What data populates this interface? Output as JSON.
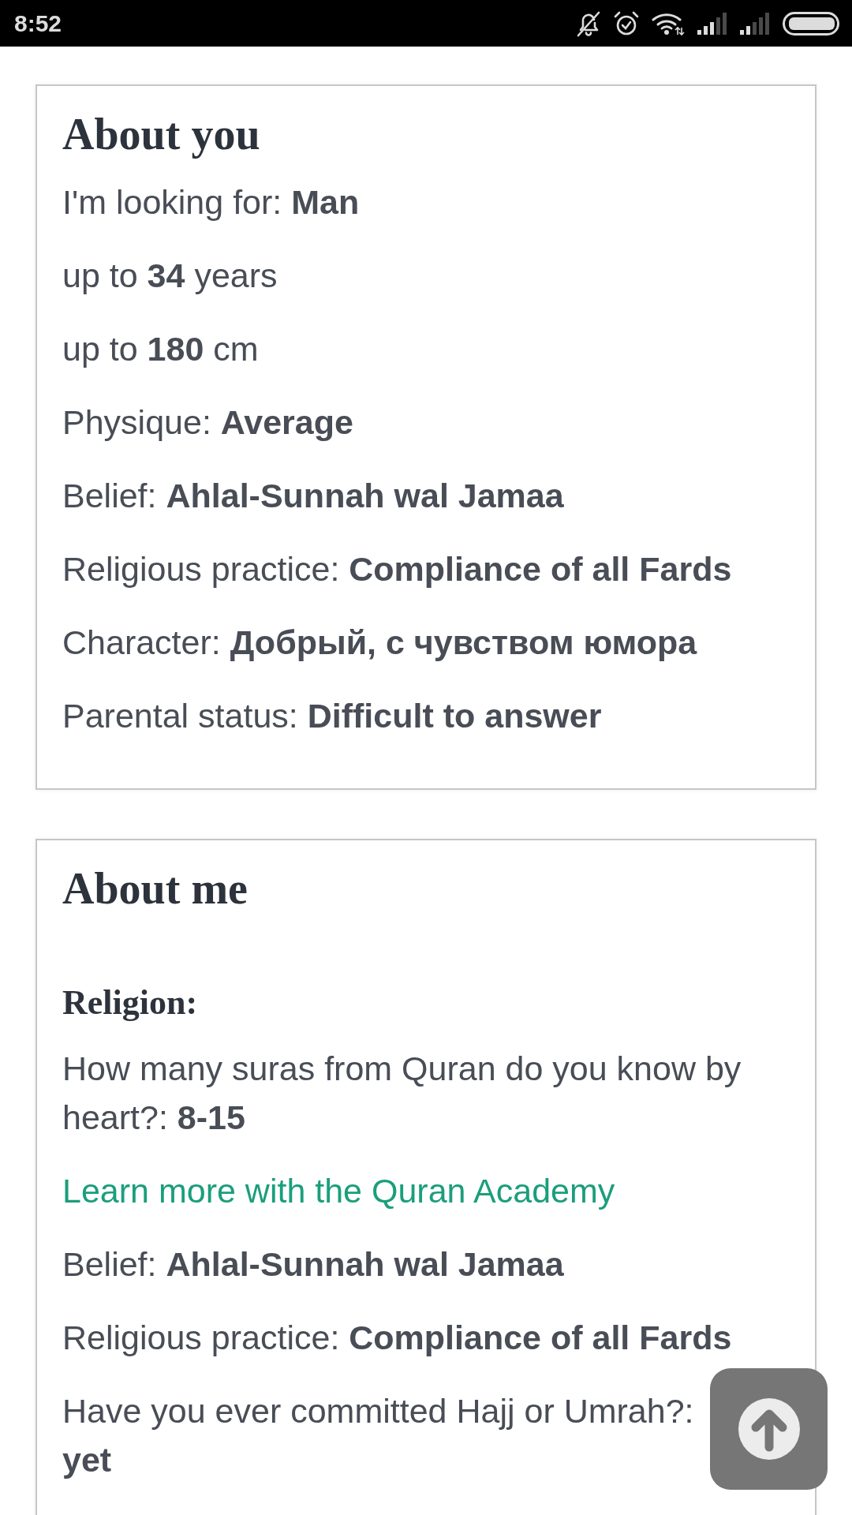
{
  "status_bar": {
    "time": "8:52"
  },
  "sections": [
    {
      "title": "About you",
      "items": [
        {
          "kind": "text",
          "text": "I'm looking for: **Man**"
        },
        {
          "kind": "text",
          "text": "up to **34** years"
        },
        {
          "kind": "text",
          "text": "up to **180** cm"
        },
        {
          "kind": "text",
          "text": "Physique: **Average**"
        },
        {
          "kind": "text",
          "text": "Belief: **Ahlal-Sunnah wal Jamaa**"
        },
        {
          "kind": "text",
          "text": "Religious practice: **Compliance of all Fards**"
        },
        {
          "kind": "text",
          "text": "Character: **Добрый, с чувством юмора**"
        },
        {
          "kind": "text",
          "text": "Parental status: **Difficult to answer**"
        }
      ]
    },
    {
      "title": "About me",
      "groups": [
        {
          "heading": "Religion:",
          "items": [
            {
              "kind": "text",
              "text": "How many suras from Quran do you know by heart?: **8-15**"
            },
            {
              "kind": "link",
              "text": "Learn more with the Quran Academy"
            },
            {
              "kind": "text",
              "text": "Belief: **Ahlal-Sunnah wal Jamaa**"
            },
            {
              "kind": "text",
              "text": "Religious practice: **Compliance of all Fards**"
            },
            {
              "kind": "stacked",
              "label": "Have you ever committed Hajj or Umrah?:",
              "value": "yet"
            }
          ]
        }
      ]
    }
  ]
}
